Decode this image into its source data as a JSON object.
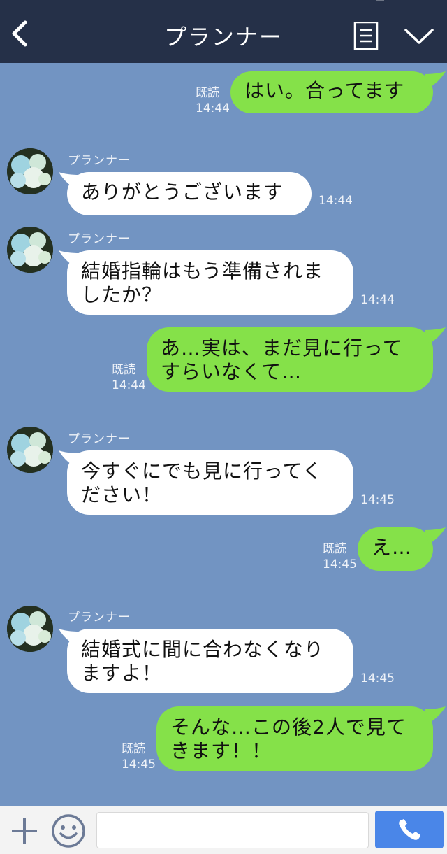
{
  "header": {
    "title": "プランナー",
    "back_icon": "chevron-left-icon",
    "menu_icon": "menu-list-icon",
    "collapse_icon": "chevron-down-icon"
  },
  "messages": [
    {
      "direction": "out",
      "text": "はい。合ってます",
      "read": "既読",
      "time": "14:44"
    },
    {
      "direction": "in",
      "sender": "プランナー",
      "text": "ありがとうございます",
      "time": "14:44"
    },
    {
      "direction": "in",
      "sender": "プランナー",
      "text_line1": "結婚指輪はもう準備されま",
      "text_line2": "したか？",
      "time": "14:44"
    },
    {
      "direction": "out",
      "text_line1": "あ…実は、まだ見に行って",
      "text_line2": "すらいなくて…",
      "read": "既読",
      "time": "14:44"
    },
    {
      "direction": "in",
      "sender": "プランナー",
      "text_line1": "今すぐにでも見に行ってく",
      "text_line2": "ださい！",
      "time": "14:45"
    },
    {
      "direction": "out",
      "text": "え…",
      "read": "既読",
      "time": "14:45"
    },
    {
      "direction": "in",
      "sender": "プランナー",
      "text_line1": "結婚式に間に合わなくなり",
      "text_line2": "ますよ！",
      "time": "14:45"
    },
    {
      "direction": "out",
      "text_line1": "そんな…この後2人で見て",
      "text_line2": "きます！！",
      "read": "既読",
      "time": "14:45"
    }
  ],
  "footer": {
    "input_value": "",
    "plus_icon": "plus-icon",
    "sticker_icon": "smiley-icon",
    "send_icon": "phone-icon"
  },
  "colors": {
    "header_bg": "#253048",
    "chat_bg": "#7294c2",
    "out_bubble": "#85e149",
    "in_bubble": "#ffffff",
    "send_button": "#4a86e8"
  }
}
